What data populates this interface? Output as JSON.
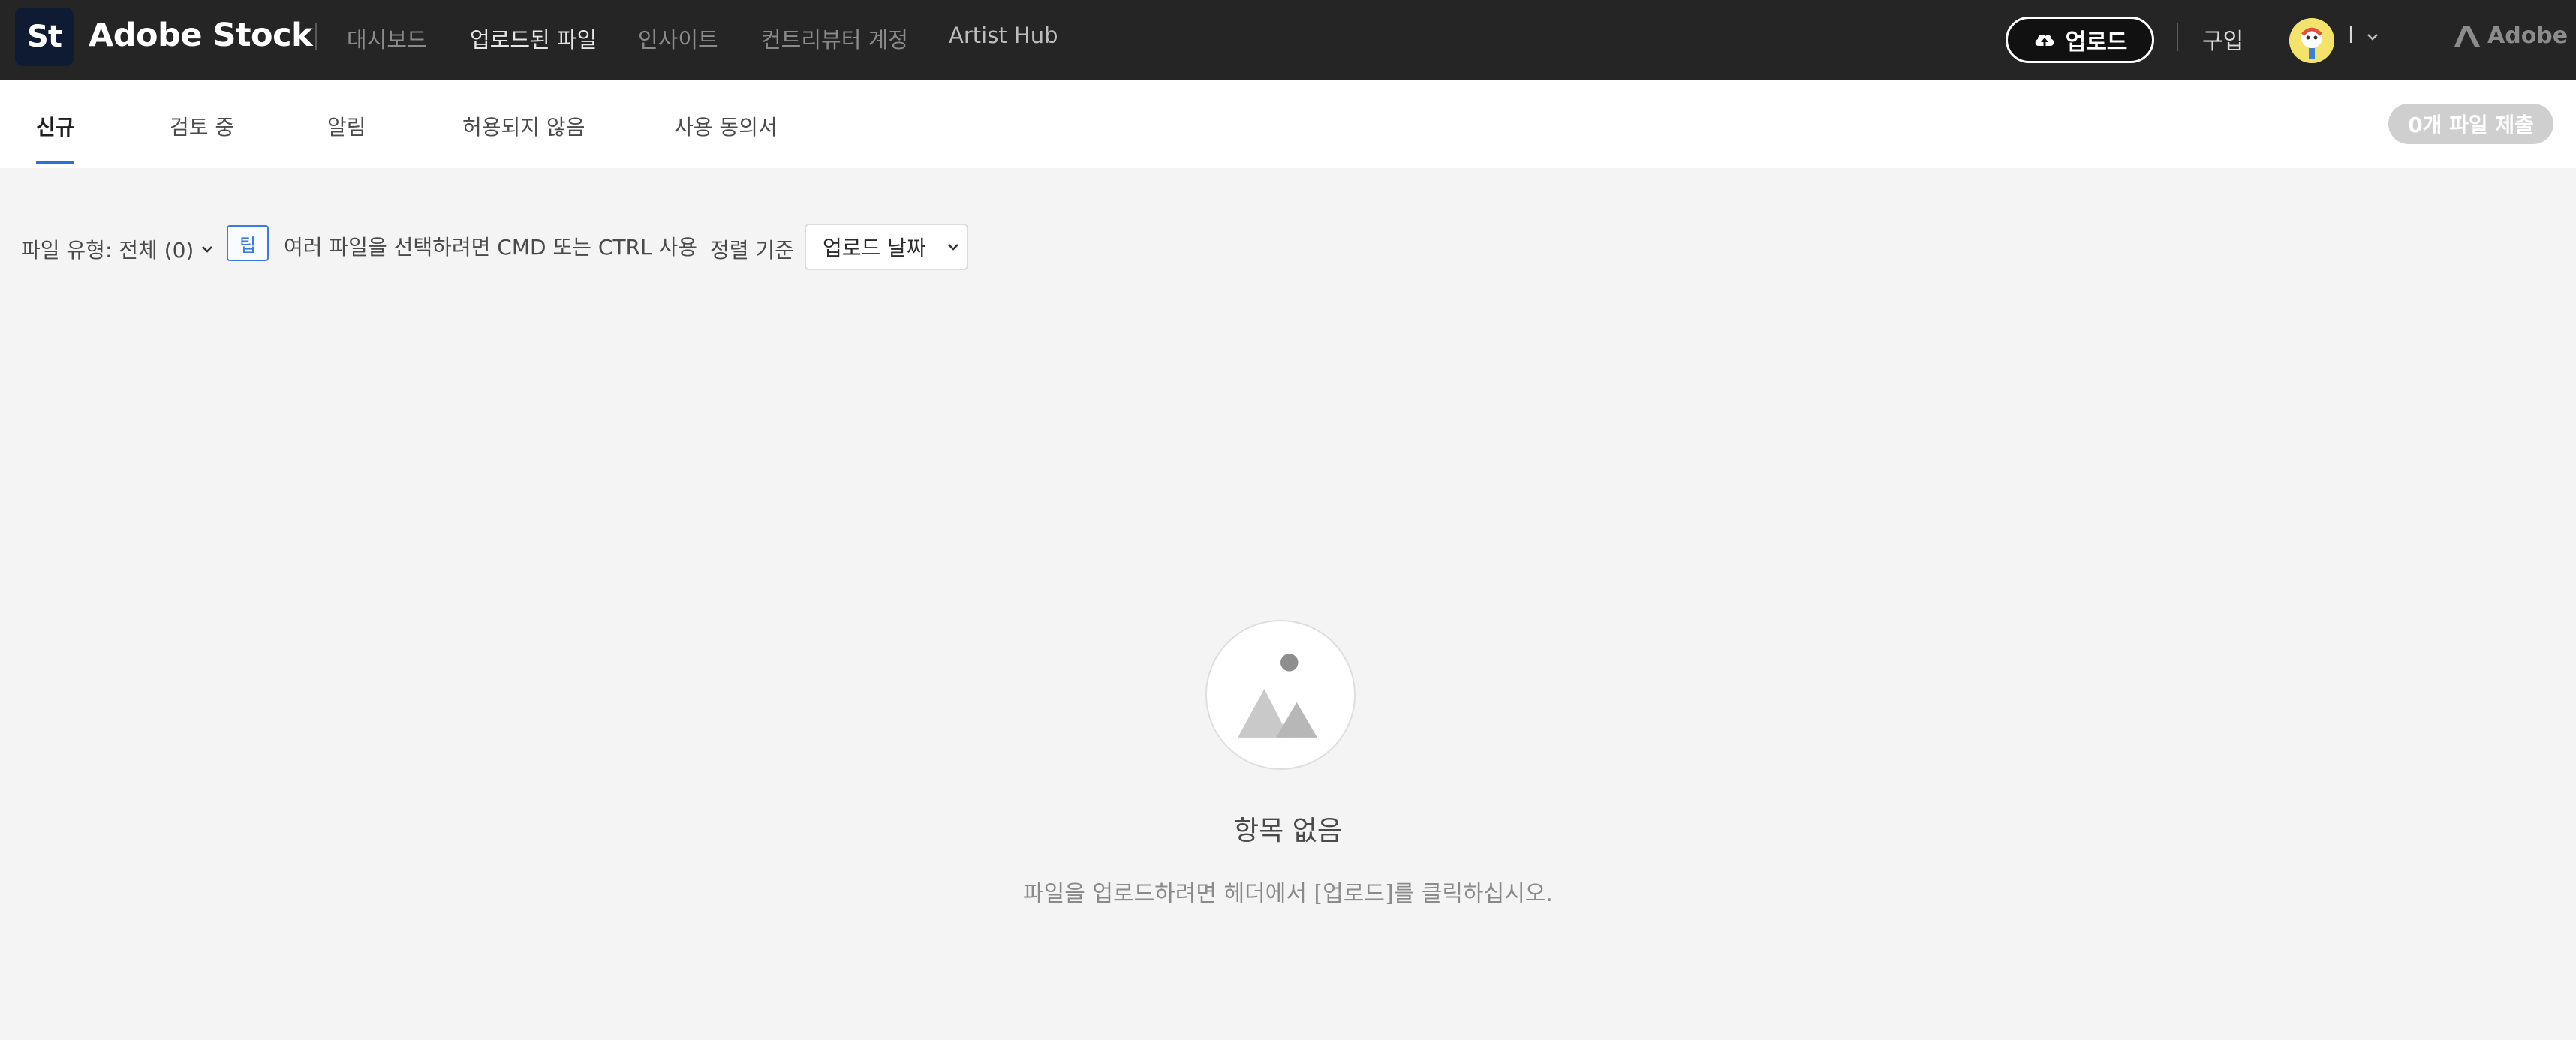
{
  "header": {
    "logo_text": "St",
    "brand": "Adobe Stock",
    "nav": [
      {
        "label": "대시보드"
      },
      {
        "label": "업로드된 파일"
      },
      {
        "label": "인사이트"
      },
      {
        "label": "컨트리뷰터 계정"
      },
      {
        "label": "Artist Hub"
      }
    ],
    "upload_label": "업로드",
    "buy_label": "구입",
    "user_name": "I",
    "adobe_label": "Adobe"
  },
  "tabs": [
    {
      "label": "신규"
    },
    {
      "label": "검토 중"
    },
    {
      "label": "알림"
    },
    {
      "label": "허용되지 않음"
    },
    {
      "label": "사용 동의서"
    }
  ],
  "submit_label": "0개 파일 제출",
  "toolbar": {
    "filetype_label": "파일 유형: 전체 (0)",
    "tip_badge": "팁",
    "tip_text": "여러 파일을 선택하려면 CMD 또는 CTRL 사용",
    "sort_label": "정렬 기준",
    "sort_value": "업로드 날짜"
  },
  "empty_state": {
    "title": "항목 없음",
    "subtitle": "파일을 업로드하려면 헤더에서 [업로드]를 클릭하십시오."
  },
  "colors": {
    "header_bg": "#252525",
    "accent": "#2d6fd6",
    "page_bg": "#f4f4f4"
  }
}
